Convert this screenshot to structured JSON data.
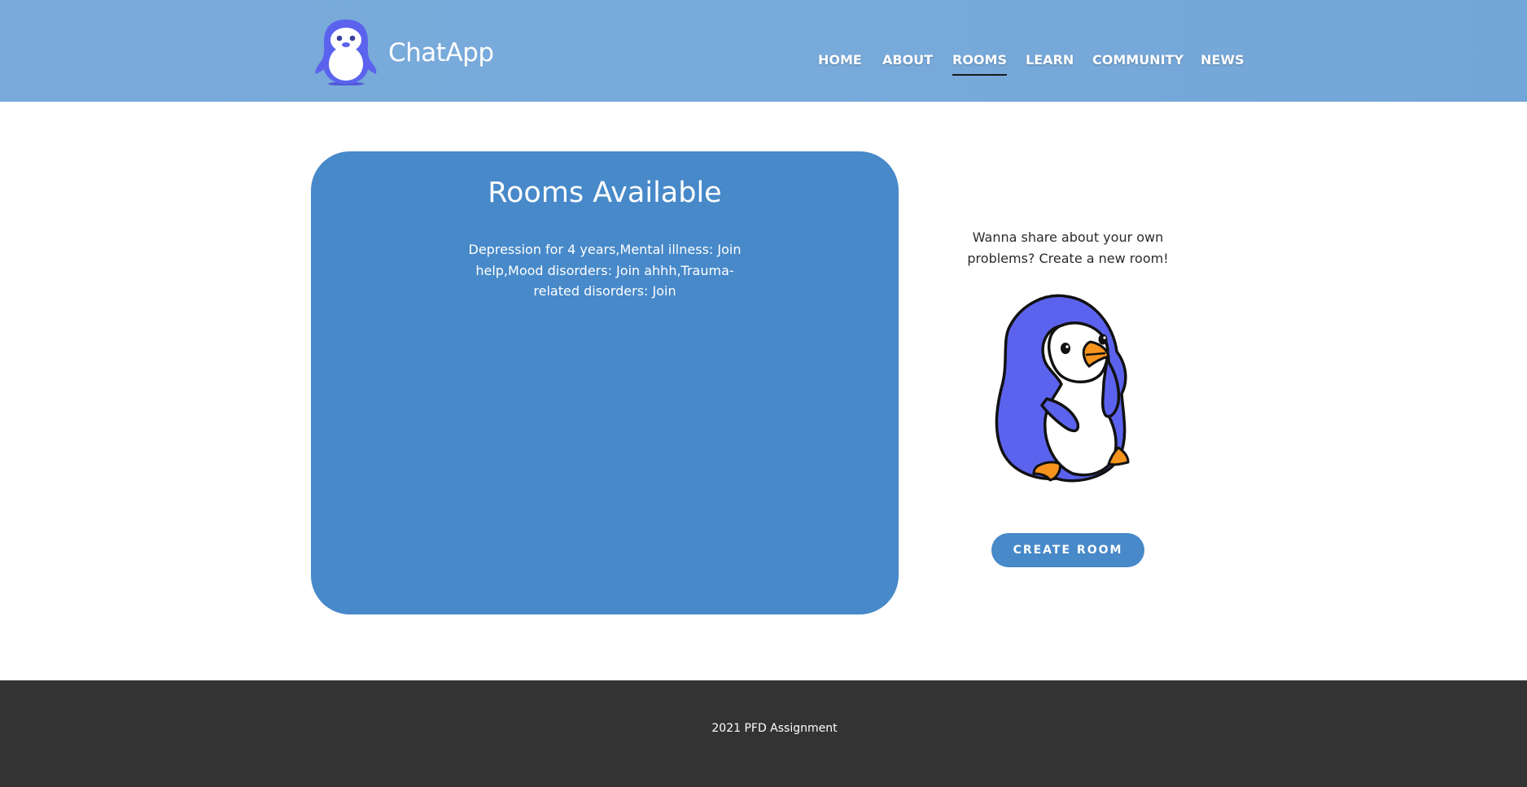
{
  "header": {
    "brand": "ChatApp",
    "nav": [
      {
        "label": "HOME",
        "active": false
      },
      {
        "label": "ABOUT",
        "active": false
      },
      {
        "label": "ROOMS",
        "active": true
      },
      {
        "label": "LEARN",
        "active": false
      },
      {
        "label": "COMMUNITY",
        "active": false
      },
      {
        "label": "NEWS",
        "active": false
      }
    ]
  },
  "main": {
    "rooms_title": "Rooms Available",
    "rooms": [
      {
        "name": "Depression for 4 years",
        "action": "Join"
      },
      {
        "name": "Mental illness",
        "action": "Join"
      },
      {
        "name": "help",
        "action": ""
      },
      {
        "name": "Mood disorders",
        "action": "Join"
      },
      {
        "name": "ahhh",
        "action": ""
      },
      {
        "name": "Trauma-related disorders",
        "action": "Join"
      }
    ],
    "rooms_text": "Depression for 4 years,Mental illness: Join help,Mood disorders: Join ahhh,Trauma-related disorders: Join",
    "side_text": "Wanna share about your own problems? Create a new room!",
    "create_button": "CREATE ROOM"
  },
  "footer": {
    "text": "2021 PFD Assignment"
  },
  "colors": {
    "header_bg": "#78aadb",
    "card_bg": "#4789c9",
    "footer_bg": "#333333",
    "penguin_body": "#5b63ee",
    "beak": "#f7941d"
  },
  "icons": {
    "logo": "penguin-logo-icon",
    "illustration": "penguin-illustration"
  }
}
